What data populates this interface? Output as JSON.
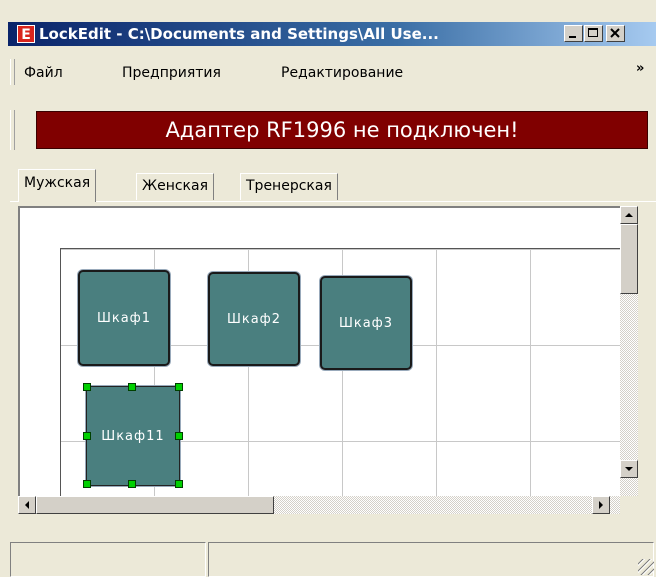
{
  "window": {
    "app_icon_letter": "E",
    "title": "LockEdit - C:\\Documents and Settings\\All Use..."
  },
  "menu": {
    "items": [
      "Файл",
      "Предприятия",
      "Редактирование"
    ],
    "overflow_glyph": "»"
  },
  "banner": {
    "text": "Адаптер RF1996 не подключен!",
    "color": "#800000"
  },
  "tabs": [
    {
      "label": "Мужская",
      "active": true
    },
    {
      "label": "Женская",
      "active": false
    },
    {
      "label": "Тренерская",
      "active": false
    }
  ],
  "lockers": [
    {
      "label": "Шкаф1",
      "selected": false
    },
    {
      "label": "Шкаф2",
      "selected": false
    },
    {
      "label": "Шкаф3",
      "selected": false
    },
    {
      "label": "Шкаф11",
      "selected": true
    }
  ],
  "colors": {
    "locker_fill": "#4a7f7f",
    "selection_handle": "#00d000"
  },
  "icons": {
    "minimize": "minimize-icon",
    "maximize": "maximize-icon",
    "close": "close-icon",
    "scroll_up": "arrow-up-icon",
    "scroll_down": "arrow-down-icon",
    "scroll_left": "arrow-left-icon",
    "scroll_right": "arrow-right-icon"
  }
}
